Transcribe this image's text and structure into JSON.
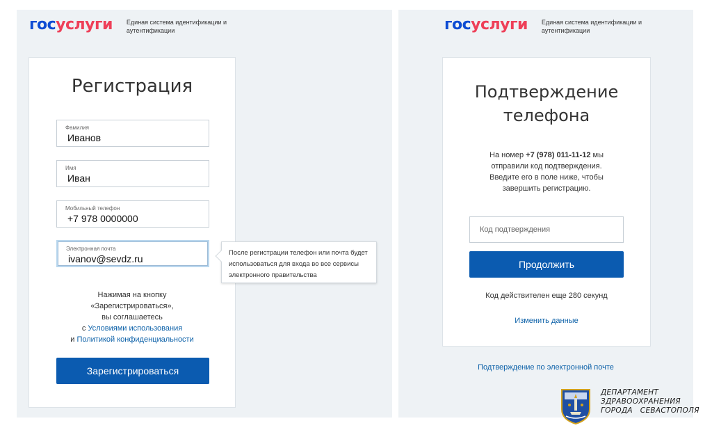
{
  "left": {
    "logo": {
      "gos": "гос",
      "uslugi": "услуги",
      "subtitle": "Единая система идентификации и аутентификации"
    },
    "title": "Регистрация",
    "fields": [
      {
        "label": "Фамилия",
        "value": "Иванов"
      },
      {
        "label": "Имя",
        "value": "Иван"
      },
      {
        "label": "Мобильный телефон",
        "value": "+7 978 0000000"
      },
      {
        "label": "Электронная почта",
        "value": "ivanov@sevdz.ru"
      }
    ],
    "agreement": {
      "line1": "Нажимая на кнопку",
      "line2": "«Зарегистрироваться»,",
      "line3": "вы соглашаетесь",
      "prefix4": "с ",
      "link_terms": "Условиями использования",
      "prefix5": "и ",
      "link_privacy": "Политикой конфиденциальности"
    },
    "register_button": "Зарегистрироваться",
    "tooltip": "После регистрации телефон или почта будет использоваться для входа во все сервисы электронного правительства"
  },
  "right": {
    "logo": {
      "gos": "гос",
      "uslugi": "услуги",
      "subtitle": "Единая система идентификации и аутентификации"
    },
    "title_line1": "Подтверждение",
    "title_line2": "телефона",
    "info": {
      "pre": "На номер ",
      "phone": "+7 (978) 011-11-12",
      "post": " мы",
      "line2": "отправили код подтверждения.",
      "line3": "Введите его в поле ниже, чтобы",
      "line4": "завершить регистрацию."
    },
    "code_placeholder": "Код подтверждения",
    "continue_button": "Продолжить",
    "timer": "Код действителен еще 280 секунд",
    "change_link": "Изменить данные",
    "email_link": "Подтверждение по электронной почте"
  },
  "department": {
    "line1": "ДЕПАРТАМЕНТ",
    "line2": "ЗДРАВООХРАНЕНИЯ",
    "line3": "ГОРОДА   СЕВАСТОПОЛЯ",
    "emblem_icon": "sevastopol-coat-of-arms-icon"
  },
  "colors": {
    "brand_blue": "#0d4cd3",
    "brand_red": "#ee3f58",
    "button": "#0b5bb0",
    "link": "#0b60a8",
    "panel_bg": "#eef2f5"
  }
}
